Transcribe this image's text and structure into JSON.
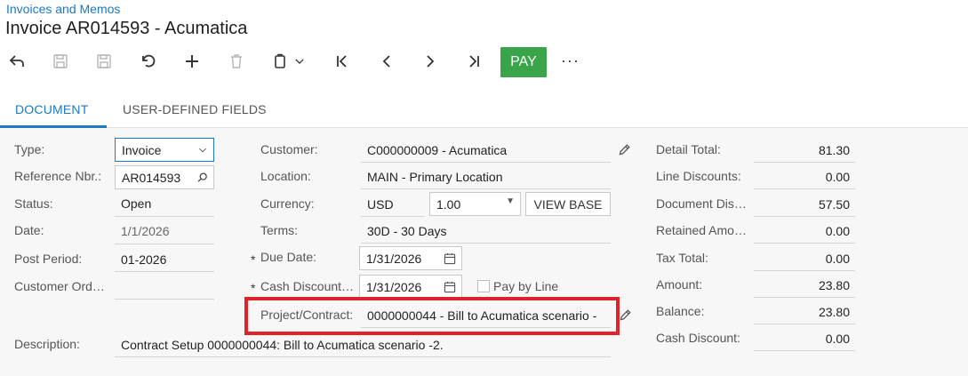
{
  "header": {
    "breadcrumb": "Invoices and Memos",
    "title": "Invoice AR014593 - Acumatica"
  },
  "toolbar": {
    "pay_label": "PAY",
    "more_label": "···"
  },
  "tabs": [
    {
      "label": "DOCUMENT"
    },
    {
      "label": "USER-DEFINED FIELDS"
    }
  ],
  "form": {
    "type": {
      "label": "Type:",
      "value": "Invoice"
    },
    "reference": {
      "label": "Reference Nbr.:",
      "value": "AR014593"
    },
    "status": {
      "label": "Status:",
      "value": "Open"
    },
    "date": {
      "label": "Date:",
      "value": "1/1/2026"
    },
    "post_period": {
      "label": "Post Period:",
      "value": "01-2026"
    },
    "customer_order": {
      "label": "Customer Ord…",
      "value": ""
    },
    "description": {
      "label": "Description:",
      "value": "Contract Setup 0000000044: Bill to Acumatica scenario -2."
    },
    "customer": {
      "label": "Customer:",
      "value": "C000000009 - Acumatica"
    },
    "location": {
      "label": "Location:",
      "value": "MAIN - Primary Location"
    },
    "currency": {
      "label": "Currency:",
      "value": "USD",
      "rate": "1.00",
      "view_base_label": "VIEW BASE"
    },
    "terms": {
      "label": "Terms:",
      "value": "30D - 30 Days"
    },
    "due_date": {
      "label": "Due Date:",
      "value": "1/31/2026"
    },
    "cash_discount_date": {
      "label": "Cash Discount…",
      "value": "1/31/2026"
    },
    "pay_by_line": {
      "label": "Pay by Line",
      "checked": false
    },
    "project": {
      "label": "Project/Contract:",
      "value": "0000000044 - Bill to Acumatica scenario -"
    },
    "required_mark": "*"
  },
  "totals": [
    {
      "label": "Detail Total:",
      "value": "81.30"
    },
    {
      "label": "Line Discounts:",
      "value": "0.00"
    },
    {
      "label": "Document Dis…",
      "value": "57.50"
    },
    {
      "label": "Retained Amo…",
      "value": "0.00"
    },
    {
      "label": "Tax Total:",
      "value": "0.00"
    },
    {
      "label": "Amount:",
      "value": "23.80"
    },
    {
      "label": "Balance:",
      "value": "23.80"
    },
    {
      "label": "Cash Discount:",
      "value": "0.00"
    }
  ],
  "colors": {
    "accent": "#1a7ac4",
    "pay_button": "#3aa44a",
    "highlight": "#e0222a"
  }
}
